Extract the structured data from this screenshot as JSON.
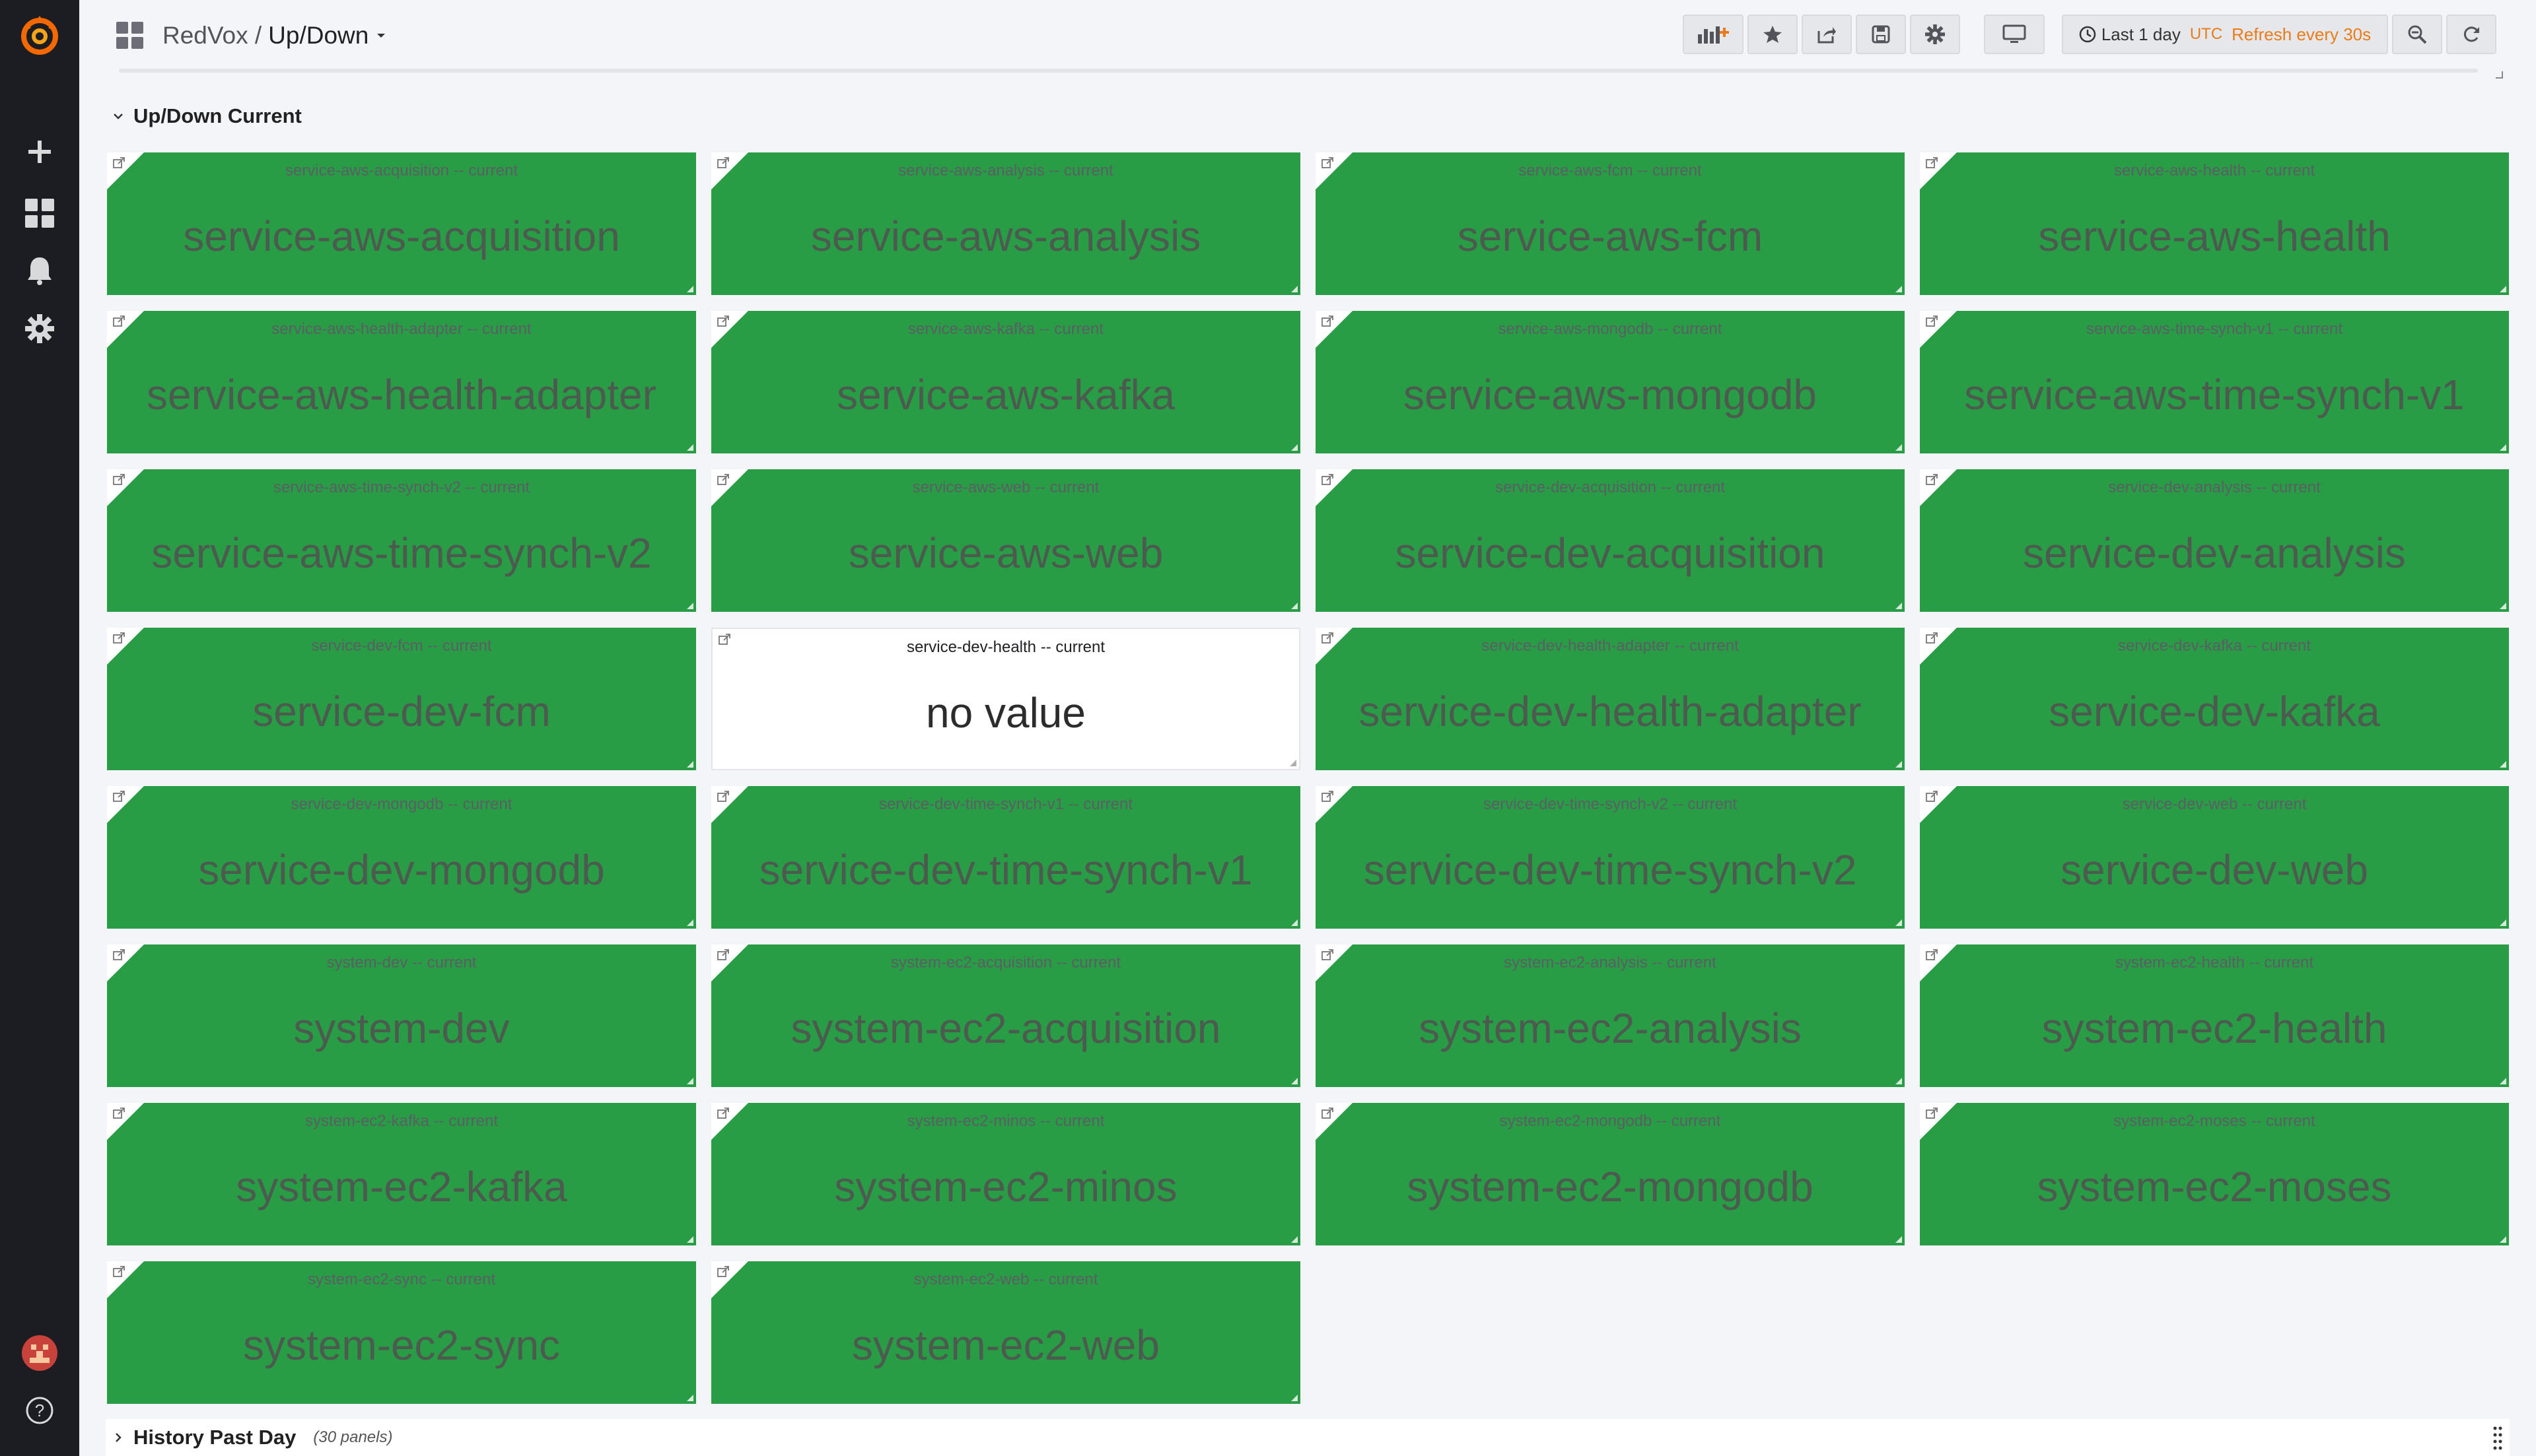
{
  "breadcrumb": {
    "folder": "RedVox /",
    "dashboard": "Up/Down"
  },
  "toolbar": {
    "icons": [
      "add-panel-icon",
      "star-icon",
      "share-icon",
      "save-icon",
      "settings-icon",
      "tv-icon"
    ],
    "time_range": "Last 1 day",
    "timezone": "UTC",
    "refresh": "Refresh every 30s"
  },
  "sidebar": {
    "icons": [
      "grafana-logo",
      "plus-icon",
      "dashboards-icon",
      "bell-icon",
      "gear-icon",
      "avatar",
      "help-icon"
    ]
  },
  "rows": {
    "current": {
      "title": "Up/Down Current"
    },
    "history": {
      "title": "History Past Day",
      "count": "(30 panels)"
    }
  },
  "colors": {
    "up": "#299c46",
    "no_value": "#ffffff",
    "accent": "#eb7b18",
    "sidebar": "#1c1d22"
  },
  "panels": [
    {
      "title": "service-aws-acquisition -- current",
      "value": "service-aws-acquisition",
      "state": "up"
    },
    {
      "title": "service-aws-analysis -- current",
      "value": "service-aws-analysis",
      "state": "up"
    },
    {
      "title": "service-aws-fcm -- current",
      "value": "service-aws-fcm",
      "state": "up"
    },
    {
      "title": "service-aws-health -- current",
      "value": "service-aws-health",
      "state": "up"
    },
    {
      "title": "service-aws-health-adapter -- current",
      "value": "service-aws-health-adapter",
      "state": "up"
    },
    {
      "title": "service-aws-kafka -- current",
      "value": "service-aws-kafka",
      "state": "up"
    },
    {
      "title": "service-aws-mongodb -- current",
      "value": "service-aws-mongodb",
      "state": "up"
    },
    {
      "title": "service-aws-time-synch-v1 -- current",
      "value": "service-aws-time-synch-v1",
      "state": "up"
    },
    {
      "title": "service-aws-time-synch-v2 -- current",
      "value": "service-aws-time-synch-v2",
      "state": "up"
    },
    {
      "title": "service-aws-web -- current",
      "value": "service-aws-web",
      "state": "up"
    },
    {
      "title": "service-dev-acquisition -- current",
      "value": "service-dev-acquisition",
      "state": "up"
    },
    {
      "title": "service-dev-analysis -- current",
      "value": "service-dev-analysis",
      "state": "up"
    },
    {
      "title": "service-dev-fcm -- current",
      "value": "service-dev-fcm",
      "state": "up"
    },
    {
      "title": "service-dev-health -- current",
      "value": "no value",
      "state": "no-value"
    },
    {
      "title": "service-dev-health-adapter -- current",
      "value": "service-dev-health-adapter",
      "state": "up"
    },
    {
      "title": "service-dev-kafka -- current",
      "value": "service-dev-kafka",
      "state": "up"
    },
    {
      "title": "service-dev-mongodb -- current",
      "value": "service-dev-mongodb",
      "state": "up"
    },
    {
      "title": "service-dev-time-synch-v1 -- current",
      "value": "service-dev-time-synch-v1",
      "state": "up"
    },
    {
      "title": "service-dev-time-synch-v2 -- current",
      "value": "service-dev-time-synch-v2",
      "state": "up"
    },
    {
      "title": "service-dev-web -- current",
      "value": "service-dev-web",
      "state": "up"
    },
    {
      "title": "system-dev -- current",
      "value": "system-dev",
      "state": "up"
    },
    {
      "title": "system-ec2-acquisition -- current",
      "value": "system-ec2-acquisition",
      "state": "up"
    },
    {
      "title": "system-ec2-analysis -- current",
      "value": "system-ec2-analysis",
      "state": "up"
    },
    {
      "title": "system-ec2-health -- current",
      "value": "system-ec2-health",
      "state": "up"
    },
    {
      "title": "system-ec2-kafka -- current",
      "value": "system-ec2-kafka",
      "state": "up"
    },
    {
      "title": "system-ec2-minos -- current",
      "value": "system-ec2-minos",
      "state": "up"
    },
    {
      "title": "system-ec2-mongodb -- current",
      "value": "system-ec2-mongodb",
      "state": "up"
    },
    {
      "title": "system-ec2-moses -- current",
      "value": "system-ec2-moses",
      "state": "up"
    },
    {
      "title": "system-ec2-sync -- current",
      "value": "system-ec2-sync",
      "state": "up"
    },
    {
      "title": "system-ec2-web -- current",
      "value": "system-ec2-web",
      "state": "up"
    }
  ]
}
